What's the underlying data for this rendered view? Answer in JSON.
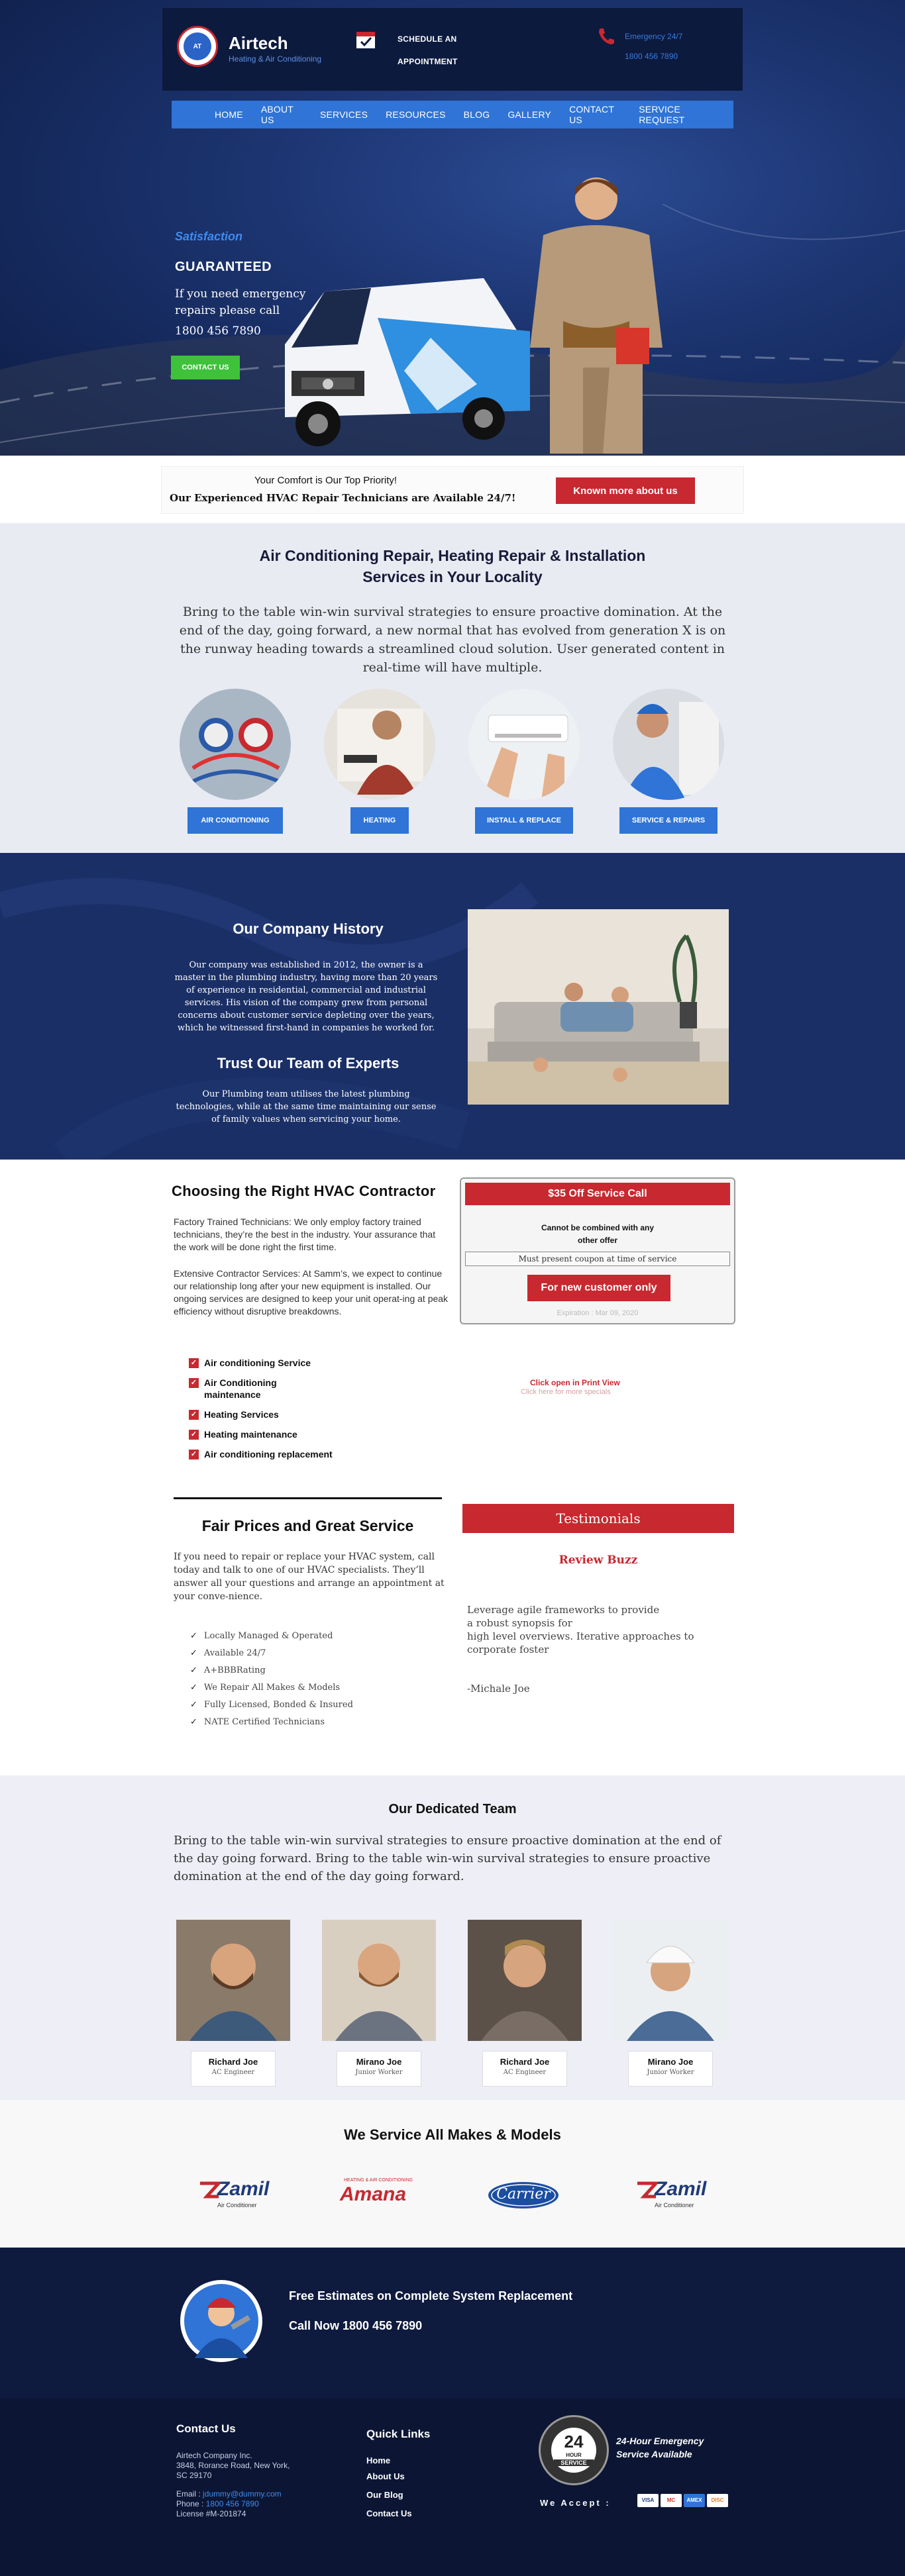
{
  "header": {
    "brand": "Airtech",
    "brand_tagline": "Heating & Air Conditioning",
    "schedule_line1": "SCHEDULE AN",
    "schedule_line2": "APPOINTMENT",
    "emergency_label": "Emergency 24/7",
    "emergency_phone": "1800 456 7890"
  },
  "nav": {
    "items": [
      "HOME",
      "ABOUT US",
      "SERVICES",
      "RESOURCES",
      "BLOG",
      "GALLERY",
      "CONTACT US",
      "SERVICE REQUEST"
    ]
  },
  "hero": {
    "satisfaction": "Satisfaction",
    "guaranteed": "GUARANTEED",
    "line": "If you need emergency repairs please call",
    "phone": "1800 456 7890",
    "button": "CONTACT US"
  },
  "priority": {
    "line1": "Your Comfort is Our Top Priority!",
    "line2": "Our Experienced HVAC Repair Technicians are Available 24/7!",
    "button": "Known more about us"
  },
  "services": {
    "title_line1": "Air Conditioning Repair, Heating Repair & Installation",
    "title_line2": "Services in Your Locality",
    "text": "Bring to the table win-win survival strategies to ensure proactive domination. At the end of the day, going forward, a new normal that has evolved from generation X is on the runway heading towards a streamlined cloud solution. User generated content in real-time will have multiple.",
    "items": [
      {
        "label": "AIR CONDITIONING"
      },
      {
        "label": "HEATING"
      },
      {
        "label": "INSTALL & REPLACE"
      },
      {
        "label": "SERVICE & REPAIRS"
      }
    ]
  },
  "history": {
    "title": "Our Company History",
    "text": "Our company was established in 2012, the owner is a master in the plumbing industry, having more than 20 years of experience in residential, commercial and industrial services. His vision of the company grew from personal concerns about customer service depleting over the years, which he witnessed first-hand in companies he worked for.",
    "experts_title": "Trust Our Team of Experts",
    "experts_text": "Our Plumbing team utilises the latest plumbing technologies, while at the same time maintaining our sense of family values when servicing your home."
  },
  "hvac": {
    "title": "Choosing the Right HVAC Contractor",
    "para1": "Factory Trained Technicians: We only employ factory trained technicians, they’re the best in the industry. Your assurance that the work will be done right the first time.",
    "para2": "Extensive Contractor Services: At Samm’s, we expect to continue our relationship long after your new equipment is installed. Our ongoing services are designed to keep your unit operat-ing at peak efficiency without disruptive breakdowns.",
    "checklist": [
      "Air conditioning Service",
      "Air Conditioning maintenance",
      "Heating Services",
      "Heating maintenance",
      "Air conditioning replacement"
    ],
    "coupon": {
      "title": "$35 Off Service Call",
      "line1": "Cannot be combined with any",
      "line2": "other offer",
      "note": "Must present coupon at time of service",
      "button": "For new customer only",
      "expires": "Expiration : Mar 09, 2020"
    },
    "print_line1": "Click open in Print View",
    "print_line2": "Click here for more specials"
  },
  "fair": {
    "title": "Fair Prices and Great Service",
    "text": "If you need to repair or replace your HVAC system, call today and talk to one of our HVAC specialists. They’ll answer all your questions and arrange an appointment at your conve-nience.",
    "list": [
      "Locally Managed & Operated",
      "Available 24/7",
      "A+BBBRating",
      "We Repair All Makes & Models",
      "Fully Licensed, Bonded & Insured",
      "NATE Certified Technicians"
    ]
  },
  "testimonials": {
    "title": "Testimonials",
    "source": "Review Buzz",
    "quote_line1": "Leverage agile frameworks to provide",
    "quote_line2": "a robust synopsis for",
    "quote_line3": "high level overviews. Iterative approaches to corporate foster",
    "author": "-Michale Joe"
  },
  "team": {
    "title": "Our Dedicated Team",
    "text": "Bring to the table win-win survival strategies to ensure proactive domination at the end of the day going forward. Bring to the table win-win survival strategies to ensure proactive domination at the end of the day going forward.",
    "members": [
      {
        "name": "Richard Joe",
        "role": "AC Engineer"
      },
      {
        "name": "Mirano Joe",
        "role": "Junior Worker"
      },
      {
        "name": "Richard Joe",
        "role": "AC Engineer"
      },
      {
        "name": "Mirano Joe",
        "role": "Junior Worker"
      }
    ]
  },
  "brands": {
    "title": "We Service All Makes & Models",
    "items": [
      {
        "name": "Zamil",
        "sub": "Air Conditioner"
      },
      {
        "name": "Amana",
        "sub": "HEATING & AIR CONDITIONING"
      },
      {
        "name": "Carrier",
        "sub": ""
      },
      {
        "name": "Zamil",
        "sub": "Air Conditioner"
      }
    ]
  },
  "estimate": {
    "line1": "Free Estimates on Complete System Replacement",
    "line2": "Call Now 1800 456 7890"
  },
  "footer": {
    "contact_title": "Contact Us",
    "company": "Airtech Company Inc.",
    "address1": "3848, Rorance Road, New York,",
    "address2": "SC 29170",
    "email_label": "Email :",
    "email": "jdummy@dummy.com",
    "phone_label": "Phone :",
    "phone": "1800 456 7890",
    "license": "License #M-201874",
    "quick_title": "Quick Links",
    "links": [
      "Home",
      "About Us",
      "Our Blog",
      "Contact Us"
    ],
    "badge_number": "24",
    "badge_hour": "HOUR",
    "badge_service": "SERVICE",
    "badge_line1": "24-Hour Emergency",
    "badge_line2": "Service Available",
    "accept": "We Accept :",
    "cards": [
      "VISA",
      "MC",
      "AMEX",
      "DISC"
    ]
  },
  "colors": {
    "brand_blue": "#2f74d6",
    "navy": "#132657",
    "red": "#c8282f",
    "green": "#3ec23a",
    "light_bg": "#e8ebf2"
  }
}
